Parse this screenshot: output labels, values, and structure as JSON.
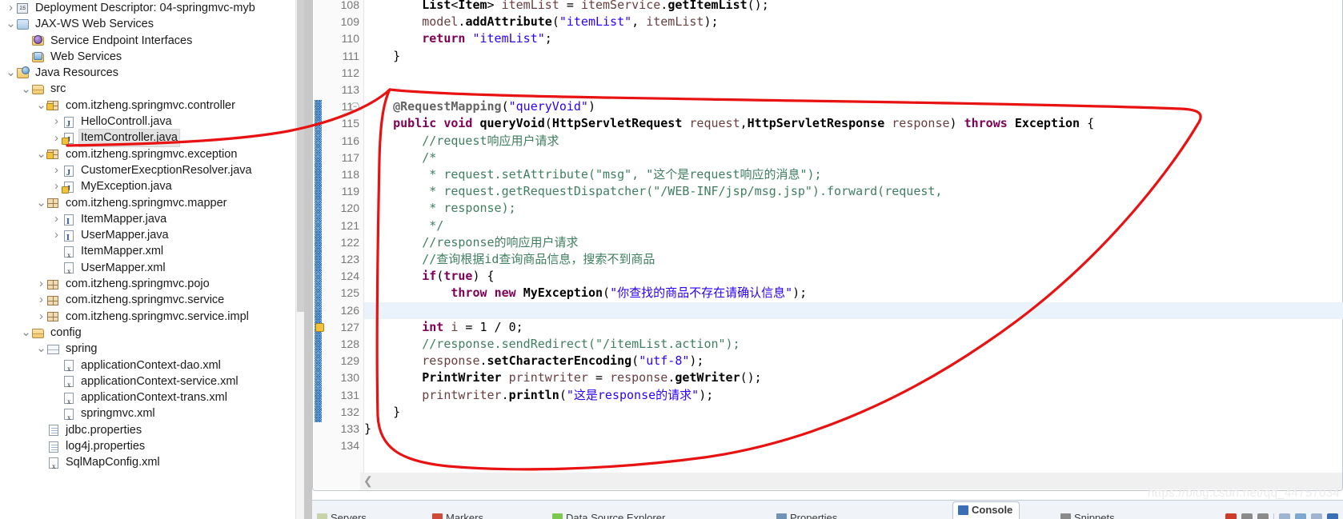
{
  "explorer": {
    "name": "package-explorer",
    "items": [
      {
        "label": "Deployment Descriptor: 04-springmvc-myb",
        "indent": 0,
        "twisty": "collapsed",
        "icon": "deployment-descriptor-icon",
        "selected": false
      },
      {
        "label": "JAX-WS Web Services",
        "indent": 0,
        "twisty": "expanded",
        "icon": "web-services-icon",
        "selected": false
      },
      {
        "label": "Service Endpoint Interfaces",
        "indent": 1,
        "twisty": "none",
        "icon": "service-endpoint-folder-icon",
        "selected": false
      },
      {
        "label": "Web Services",
        "indent": 1,
        "twisty": "none",
        "icon": "web-services-folder-icon",
        "selected": false
      },
      {
        "label": "Java Resources",
        "indent": 0,
        "twisty": "expanded",
        "icon": "java-resources-icon",
        "selected": false
      },
      {
        "label": "src",
        "indent": 1,
        "twisty": "expanded",
        "icon": "source-folder-icon",
        "selected": false
      },
      {
        "label": "com.itzheng.springmvc.controller",
        "indent": 2,
        "twisty": "expanded",
        "icon": "package-locked-icon",
        "selected": false
      },
      {
        "label": "HelloControll.java",
        "indent": 3,
        "twisty": "collapsed",
        "icon": "java-file-icon",
        "selected": false
      },
      {
        "label": "ItemController.java",
        "indent": 3,
        "twisty": "collapsed",
        "icon": "java-file-warning-icon",
        "selected": true
      },
      {
        "label": "com.itzheng.springmvc.exception",
        "indent": 2,
        "twisty": "expanded",
        "icon": "package-locked-icon",
        "selected": false
      },
      {
        "label": "CustomerExecptionResolver.java",
        "indent": 3,
        "twisty": "collapsed",
        "icon": "java-file-icon",
        "selected": false
      },
      {
        "label": "MyException.java",
        "indent": 3,
        "twisty": "collapsed",
        "icon": "java-file-warning-icon",
        "selected": false
      },
      {
        "label": "com.itzheng.springmvc.mapper",
        "indent": 2,
        "twisty": "expanded",
        "icon": "package-icon",
        "selected": false
      },
      {
        "label": "ItemMapper.java",
        "indent": 3,
        "twisty": "collapsed",
        "icon": "java-interface-icon",
        "selected": false
      },
      {
        "label": "UserMapper.java",
        "indent": 3,
        "twisty": "collapsed",
        "icon": "java-interface-icon",
        "selected": false
      },
      {
        "label": "ItemMapper.xml",
        "indent": 3,
        "twisty": "none",
        "icon": "xml-file-icon",
        "selected": false
      },
      {
        "label": "UserMapper.xml",
        "indent": 3,
        "twisty": "none",
        "icon": "xml-file-icon",
        "selected": false
      },
      {
        "label": "com.itzheng.springmvc.pojo",
        "indent": 2,
        "twisty": "collapsed",
        "icon": "package-icon",
        "selected": false
      },
      {
        "label": "com.itzheng.springmvc.service",
        "indent": 2,
        "twisty": "collapsed",
        "icon": "package-icon",
        "selected": false
      },
      {
        "label": "com.itzheng.springmvc.service.impl",
        "indent": 2,
        "twisty": "collapsed",
        "icon": "package-icon",
        "selected": false
      },
      {
        "label": "config",
        "indent": 1,
        "twisty": "expanded",
        "icon": "source-folder-icon",
        "selected": false
      },
      {
        "label": "spring",
        "indent": 2,
        "twisty": "expanded",
        "icon": "spring-folder-icon",
        "selected": false
      },
      {
        "label": "applicationContext-dao.xml",
        "indent": 3,
        "twisty": "none",
        "icon": "xml-file-icon",
        "selected": false
      },
      {
        "label": "applicationContext-service.xml",
        "indent": 3,
        "twisty": "none",
        "icon": "xml-file-icon",
        "selected": false
      },
      {
        "label": "applicationContext-trans.xml",
        "indent": 3,
        "twisty": "none",
        "icon": "xml-file-icon",
        "selected": false
      },
      {
        "label": "springmvc.xml",
        "indent": 3,
        "twisty": "none",
        "icon": "xml-file-icon",
        "selected": false
      },
      {
        "label": "jdbc.properties",
        "indent": 2,
        "twisty": "none",
        "icon": "properties-file-icon",
        "selected": false
      },
      {
        "label": "log4j.properties",
        "indent": 2,
        "twisty": "none",
        "icon": "properties-file-icon",
        "selected": false
      },
      {
        "label": "SqlMapConfig.xml",
        "indent": 2,
        "twisty": "none",
        "icon": "xml-file-icon",
        "selected": false
      }
    ]
  },
  "editor": {
    "name": "java-source-editor",
    "first_line_number": 108,
    "highlighted_line": 126,
    "folding_marker_line": 114,
    "warning_marker_line": 127,
    "changebar_from_line": 114,
    "changebar_to_line": 132,
    "lines": [
      {
        "n": 108,
        "text": "        List<Item> itemList = itemService.getItemList();"
      },
      {
        "n": 109,
        "text": "        model.addAttribute(\"itemList\", itemList);"
      },
      {
        "n": 110,
        "text": "        return \"itemList\";"
      },
      {
        "n": 111,
        "text": "    }"
      },
      {
        "n": 112,
        "text": ""
      },
      {
        "n": 113,
        "text": ""
      },
      {
        "n": 114,
        "text": "    @RequestMapping(\"queryVoid\")"
      },
      {
        "n": 115,
        "text": "    public void queryVoid(HttpServletRequest request,HttpServletResponse response) throws Exception {"
      },
      {
        "n": 116,
        "text": "        //request响应用户请求"
      },
      {
        "n": 117,
        "text": "        /*"
      },
      {
        "n": 118,
        "text": "         * request.setAttribute(\"msg\", \"这个是request响应的消息\");"
      },
      {
        "n": 119,
        "text": "         * request.getRequestDispatcher(\"/WEB-INF/jsp/msg.jsp\").forward(request,"
      },
      {
        "n": 120,
        "text": "         * response);"
      },
      {
        "n": 121,
        "text": "         */"
      },
      {
        "n": 122,
        "text": "        //response的响应用户请求"
      },
      {
        "n": 123,
        "text": "        //查询根据id查询商品信息，搜索不到商品"
      },
      {
        "n": 124,
        "text": "        if(true) {"
      },
      {
        "n": 125,
        "text": "            throw new MyException(\"你查找的商品不存在请确认信息\");"
      },
      {
        "n": 126,
        "text": "        }"
      },
      {
        "n": 127,
        "text": "        int i = 1 / 0;"
      },
      {
        "n": 128,
        "text": "        //response.sendRedirect(\"/itemList.action\");"
      },
      {
        "n": 129,
        "text": "        response.setCharacterEncoding(\"utf-8\");"
      },
      {
        "n": 130,
        "text": "        PrintWriter printwriter = response.getWriter();"
      },
      {
        "n": 131,
        "text": "        printwriter.println(\"这是response的请求\");"
      },
      {
        "n": 132,
        "text": "    }"
      },
      {
        "n": 133,
        "text": "}"
      },
      {
        "n": 134,
        "text": ""
      }
    ]
  },
  "bottom_tabs": {
    "name": "view-tab-bar",
    "tabs": [
      {
        "label": "Servers",
        "active": false
      },
      {
        "label": "Markers",
        "active": false
      },
      {
        "label": "Data Source Explorer",
        "active": false
      },
      {
        "label": "Properties",
        "active": false
      },
      {
        "label": "Console",
        "active": true
      },
      {
        "label": "Snippets",
        "active": false
      }
    ]
  },
  "annotation": {
    "name": "red-freehand-annotation",
    "color": "#e81212",
    "description": "hand-drawn red loop circling the queryVoid method body and pointing at ItemController.java in the explorer"
  },
  "watermark": {
    "text": "https://blog.csdn.net/qq_44757034"
  },
  "colors": {
    "selection_bg": "#e4e4e4",
    "highlight_line_bg": "#eaf2fb",
    "keyword": "#7f0055",
    "string": "#2a00ff",
    "comment": "#3f7f5f",
    "annotation": "#646464",
    "param": "#6a3e3e",
    "field": "#0000c0",
    "annotation_red": "#e81212"
  }
}
